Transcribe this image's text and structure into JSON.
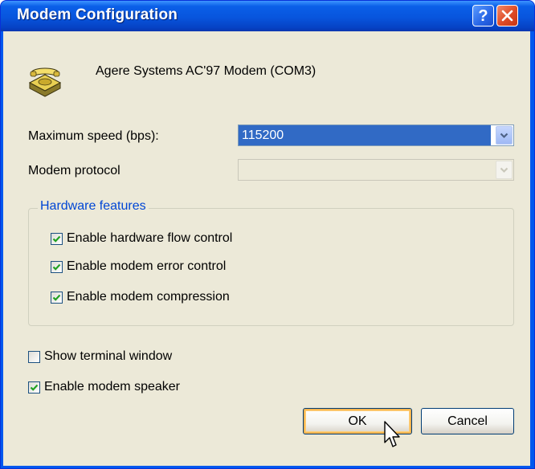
{
  "window": {
    "title": "Modem Configuration",
    "help_label": "?",
    "close_icon": "close-icon"
  },
  "device": {
    "icon": "modem-phone-icon",
    "name": "Agere Systems AC'97 Modem (COM3)"
  },
  "fields": {
    "max_speed_label": "Maximum speed (bps):",
    "max_speed_value": "115200",
    "protocol_label": "Modem protocol",
    "protocol_value": ""
  },
  "hardware": {
    "group_label": "Hardware features",
    "flow_control": {
      "label": "Enable hardware flow control",
      "checked": true
    },
    "error_control": {
      "label": "Enable modem error control",
      "checked": true
    },
    "compression": {
      "label": "Enable modem compression",
      "checked": true
    }
  },
  "options": {
    "terminal": {
      "label": "Show terminal window",
      "checked": false
    },
    "speaker": {
      "label": "Enable modem speaker",
      "checked": true
    }
  },
  "buttons": {
    "ok": "OK",
    "cancel": "Cancel"
  },
  "colors": {
    "titlebar": "#0a5fe8",
    "selection": "#316ac5",
    "group_text": "#0046d5",
    "dialog_bg": "#ece9d8"
  }
}
